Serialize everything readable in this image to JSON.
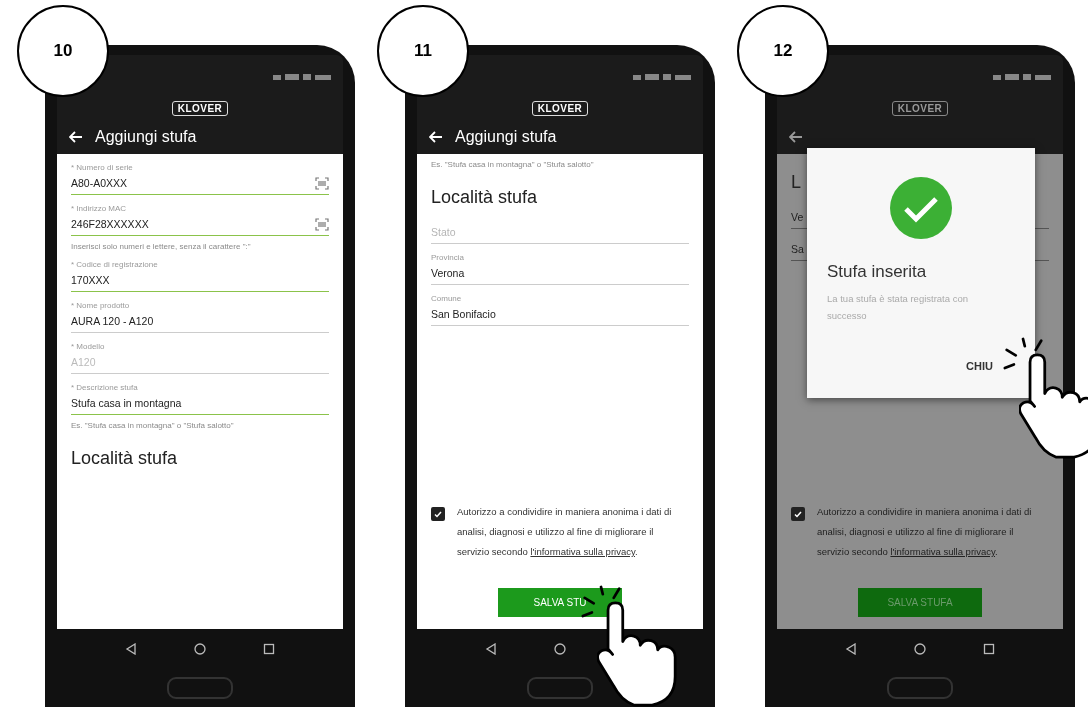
{
  "steps": [
    {
      "number": "10",
      "logo": "KLOVER",
      "title": "Aggiungi stufa",
      "dimmed": false,
      "items": [
        {
          "kind": "field",
          "label": "* Numero di serie",
          "value": "A80-A0XXX",
          "valid": true,
          "disabled": false,
          "scanner": true
        },
        {
          "kind": "field",
          "label": "* Indirizzo MAC",
          "value": "246F28XXXXXX",
          "valid": true,
          "disabled": false,
          "scanner": true
        },
        {
          "kind": "helper",
          "text": "Inserisci solo numeri e lettere, senza il carattere \":\""
        },
        {
          "kind": "field",
          "label": "* Codice di registrazione",
          "value": "170XXX",
          "valid": true,
          "disabled": false,
          "scanner": false
        },
        {
          "kind": "field",
          "label": "* Nome prodotto",
          "value": "AURA 120 - A120",
          "valid": false,
          "disabled": false,
          "scanner": false
        },
        {
          "kind": "field",
          "label": "* Modello",
          "value": "A120",
          "valid": false,
          "disabled": true,
          "scanner": false
        },
        {
          "kind": "field",
          "label": "* Descrizione stufa",
          "value": "Stufa casa in montagna",
          "valid": true,
          "disabled": false,
          "scanner": false
        },
        {
          "kind": "helper",
          "text": "Es. \"Stufa casa in montagna\" o \"Stufa salotto\""
        },
        {
          "kind": "heading",
          "text": "Località stufa"
        }
      ]
    },
    {
      "number": "11",
      "logo": "KLOVER",
      "title": "Aggiungi stufa",
      "dimmed": false,
      "items": [
        {
          "kind": "helper",
          "text": "Es. \"Stufa casa in montagna\" o \"Stufa salotto\""
        },
        {
          "kind": "heading",
          "text": "Località stufa"
        },
        {
          "kind": "field",
          "placeholder": "Stato",
          "valid": false,
          "disabled": false,
          "scanner": false
        },
        {
          "kind": "field",
          "label": "Provincia",
          "value": "Verona",
          "valid": false,
          "disabled": false,
          "scanner": false
        },
        {
          "kind": "field",
          "label": "Comune",
          "value": "San Bonifacio",
          "valid": false,
          "disabled": false,
          "scanner": false
        },
        {
          "kind": "checkbox",
          "checked": true,
          "text": "Autorizzo a condividire in maniera anonima i dati di analisi, diagnosi e utilizzo al fine di migliorare il servizio secondo ",
          "link": "l'informativa sulla privacy",
          "after": "."
        },
        {
          "kind": "button",
          "label": "SALVA STU",
          "tapped": true
        }
      ]
    },
    {
      "number": "12",
      "logo": "KLOVER",
      "dimmed": true,
      "items": [
        {
          "kind": "heading",
          "text": "L"
        },
        {
          "kind": "field",
          "value": "Ve",
          "valid": false,
          "disabled": false,
          "scanner": false
        },
        {
          "kind": "field",
          "value": "Sa",
          "valid": false,
          "disabled": false,
          "scanner": false
        },
        {
          "kind": "checkbox",
          "checked": true,
          "text": "Autorizzo a condividire in maniera anonima i dati di analisi, diagnosi e utilizzo al fine di migliorare il servizio secondo ",
          "link": "l'informativa sulla privacy",
          "after": "."
        },
        {
          "kind": "button",
          "label": "SALVA STUFA",
          "tapped": false
        }
      ],
      "dialog": {
        "title": "Stufa inserita",
        "message": "La tua stufa è stata registrata con successo",
        "action": "CHIU",
        "tapped": true
      }
    }
  ]
}
